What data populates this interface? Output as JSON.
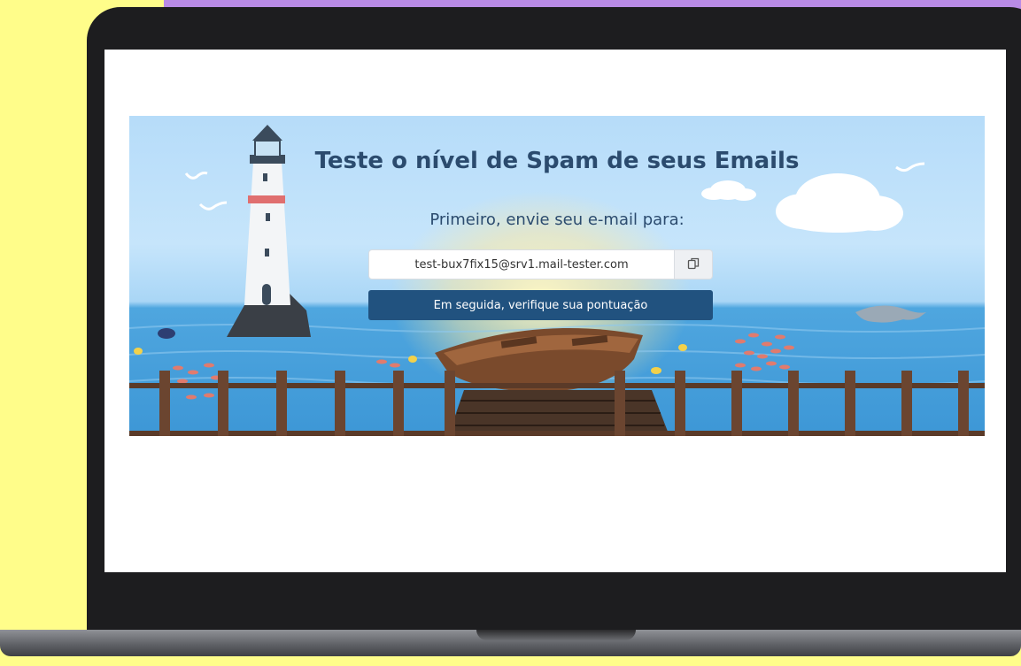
{
  "page": {
    "title": "Teste o nível de Spam de seus Emails",
    "subtitle": "Primeiro, envie seu e-mail para:",
    "email_value": "test-bux7fix15@srv1.mail-tester.com",
    "copy_icon": "copy-icon",
    "check_button_label": "Em seguida, verifique sua pontuação"
  },
  "colors": {
    "background": "#fffd8a",
    "accent_purple": "#b98be6",
    "button": "#21527f",
    "title_text": "#2b4b6e"
  }
}
